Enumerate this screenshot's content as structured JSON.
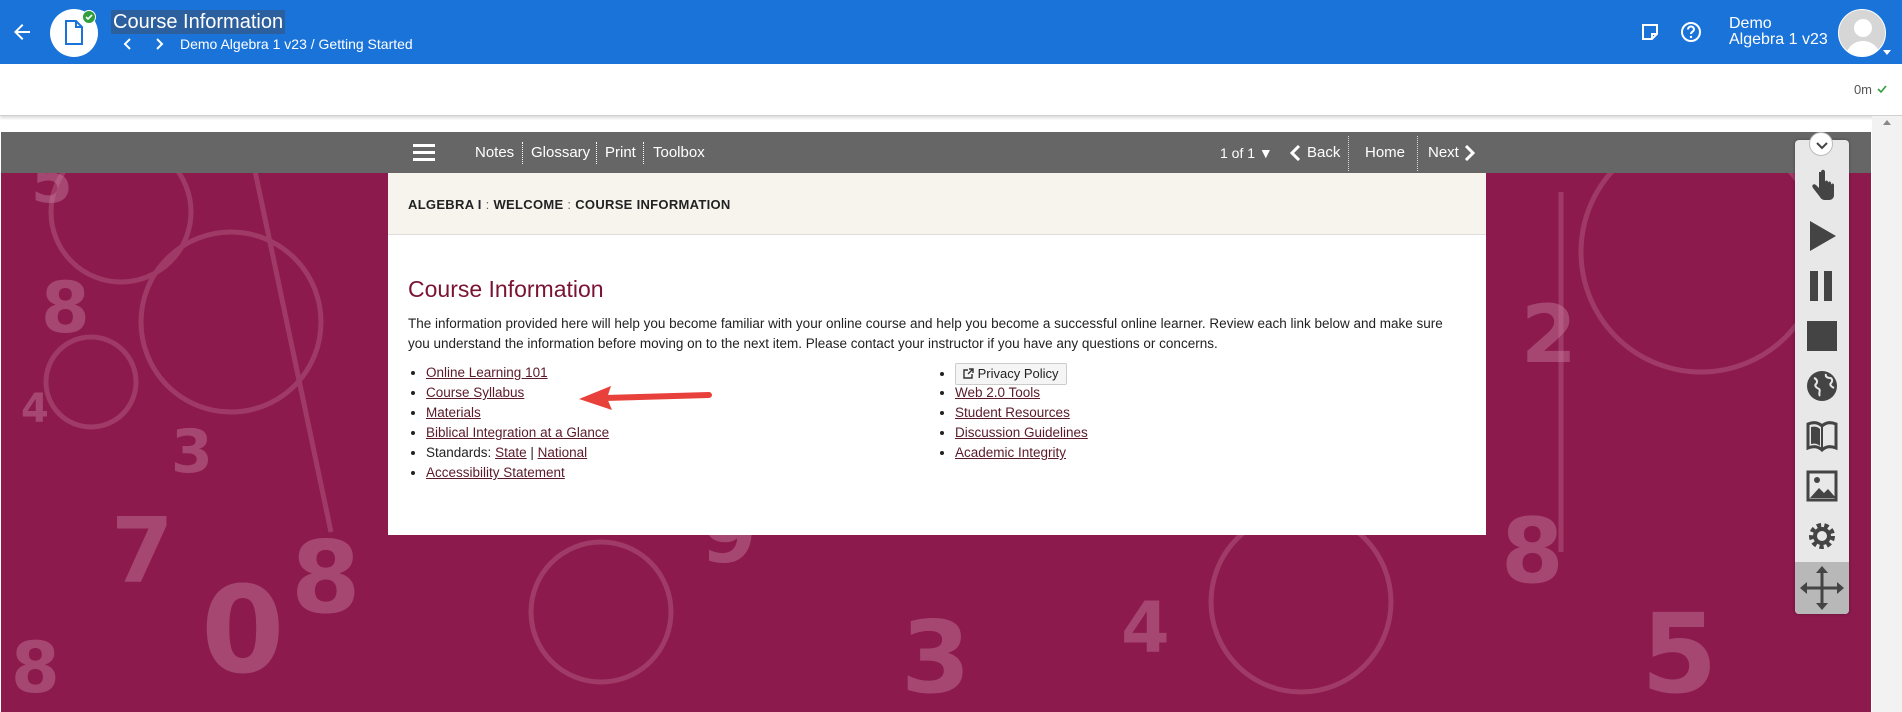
{
  "header": {
    "title": "Course Information",
    "breadcrumb": "Demo Algebra 1 v23 / Getting Started",
    "user_first": "Demo",
    "user_second": "Algebra 1 v23",
    "icons": [
      "back-arrow-icon",
      "document-icon",
      "check-icon",
      "chevron-left-icon",
      "chevron-right-icon",
      "notes-icon",
      "help-icon",
      "avatar"
    ]
  },
  "subbar": {
    "timer": "0m"
  },
  "toolbar": {
    "notes": "Notes",
    "glossary": "Glossary",
    "print": "Print",
    "toolbox": "Toolbox",
    "page_indicator": "1 of 1 ▼",
    "back": "Back",
    "home": "Home",
    "next": "Next"
  },
  "panel": {
    "crumb_1": "ALGEBRA I",
    "crumb_2": "WELCOME",
    "crumb_3": "COURSE INFORMATION",
    "crumb_sep": ":",
    "heading": "Course Information",
    "intro": "The information provided here will help you become familiar with your online course and help you become a successful online learner. Review each link below and make sure you understand the information before moving on to the next item. Please contact your instructor if you have any questions or concerns.",
    "left_links": {
      "online_learning": "Online Learning 101",
      "syllabus": "Course Syllabus",
      "materials": "Materials",
      "biblical": "Biblical Integration at a Glance",
      "standards_label": "Standards:",
      "state": "State",
      "divider": "|",
      "national": "National",
      "accessibility": "Accessibility Statement"
    },
    "right_links": {
      "privacy": "Privacy Policy",
      "web20": "Web 2.0 Tools",
      "student_resources": "Student Resources",
      "discussion": "Discussion Guidelines",
      "integrity": "Academic Integrity"
    }
  },
  "media_toolbar": {
    "buttons": [
      "hand-pointer-icon",
      "play-icon",
      "pause-icon",
      "stop-icon",
      "globe-icon",
      "book-icon",
      "image-icon",
      "gear-icon",
      "move-icon"
    ]
  },
  "colors": {
    "header_blue": "#1a73d9",
    "toolbar_gray": "#666666",
    "frame_maroon": "#8a1a4a",
    "heading_maroon": "#7a1333",
    "annotation_arrow": "#e8403a"
  }
}
